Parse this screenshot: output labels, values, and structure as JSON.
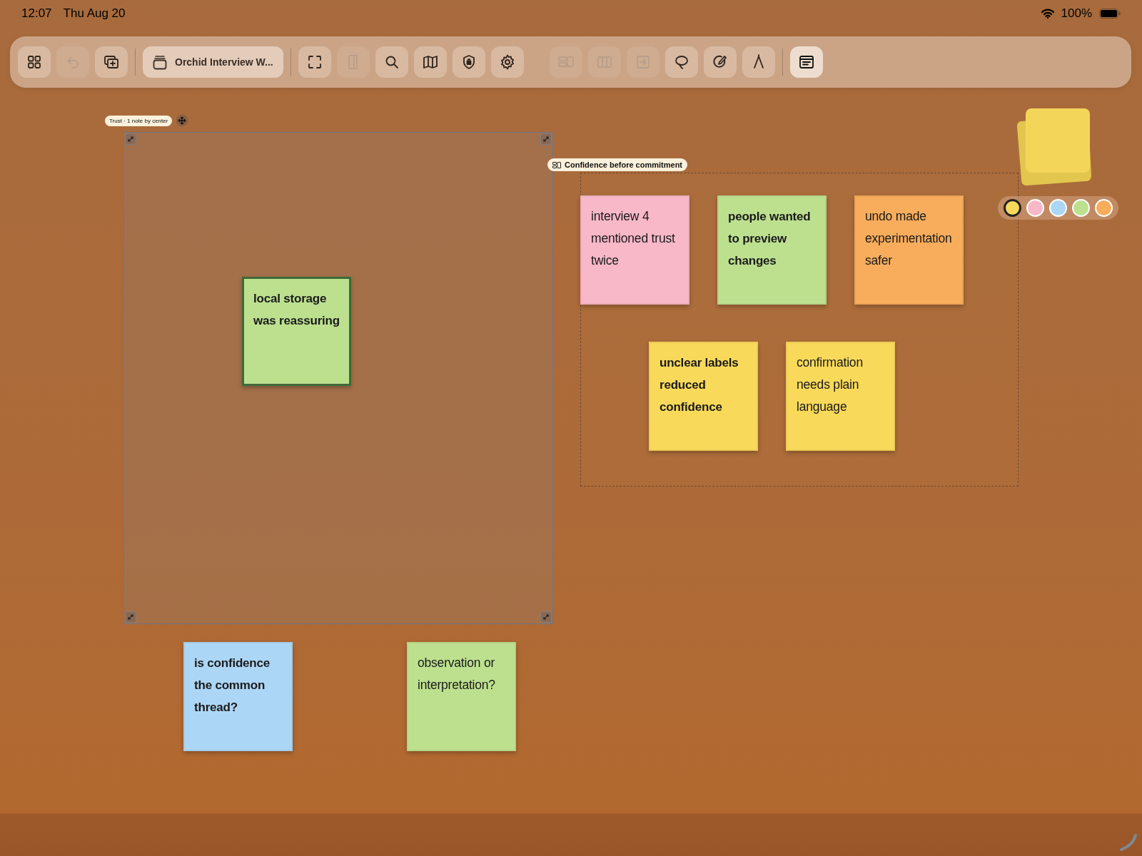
{
  "status_bar": {
    "time": "12:07",
    "date": "Thu Aug 20",
    "battery": "100%"
  },
  "toolbar": {
    "items": [
      {
        "kind": "icon",
        "disabled": false
      },
      {
        "kind": "icon",
        "disabled": true
      },
      {
        "kind": "icon",
        "disabled": false
      },
      {
        "kind": "document",
        "title": "Orchid Interview W...",
        "disabled": false
      },
      {
        "kind": "icon",
        "disabled": false
      },
      {
        "kind": "icon",
        "disabled": true
      },
      {
        "kind": "icon",
        "disabled": false
      },
      {
        "kind": "icon",
        "disabled": false
      },
      {
        "kind": "icon",
        "disabled": false
      },
      {
        "kind": "icon",
        "disabled": false
      },
      {
        "kind": "icon",
        "disabled": true
      },
      {
        "kind": "icon",
        "disabled": true
      },
      {
        "kind": "icon",
        "disabled": true
      },
      {
        "kind": "icon",
        "disabled": false
      },
      {
        "kind": "icon",
        "disabled": false
      },
      {
        "kind": "icon",
        "disabled": false
      },
      {
        "kind": "icon",
        "disabled": false,
        "selected": true
      }
    ]
  },
  "frames": [
    {
      "label": "Trust · 1 note by center",
      "kind": "selected"
    },
    {
      "label": "Confidence before commitment",
      "kind": "dashed"
    }
  ],
  "notes": [
    {
      "text": "local storage was reassuring",
      "color": "#bde08f",
      "kind": "bold",
      "selected": true
    },
    {
      "text": "interview 4 mentioned trust twice",
      "color": "#f8b8c8",
      "kind": "plain",
      "selected": false
    },
    {
      "text": "people wanted to preview changes",
      "color": "#bde08f",
      "kind": "bold",
      "selected": false
    },
    {
      "text": "undo made experimentation safer",
      "color": "#f7ad5c",
      "kind": "plain",
      "selected": false
    },
    {
      "text": "unclear labels reduced confidence",
      "color": "#f8d95a",
      "kind": "bold",
      "selected": false
    },
    {
      "text": "confirmation needs plain language",
      "color": "#f8d95a",
      "kind": "plain",
      "selected": false
    },
    {
      "text": "is confidence the common thread?",
      "color": "#acd6f5",
      "kind": "bold",
      "selected": false
    },
    {
      "text": "observation or interpretation?",
      "color": "#bde08f",
      "kind": "plain",
      "selected": false
    }
  ],
  "swatches": [
    {
      "color": "#f8d95a",
      "selected": true
    },
    {
      "color": "#f8b8c8",
      "selected": false
    },
    {
      "color": "#acd6f5",
      "selected": false
    },
    {
      "color": "#bde08f",
      "selected": false
    },
    {
      "color": "#f7ad5c",
      "selected": false
    }
  ]
}
